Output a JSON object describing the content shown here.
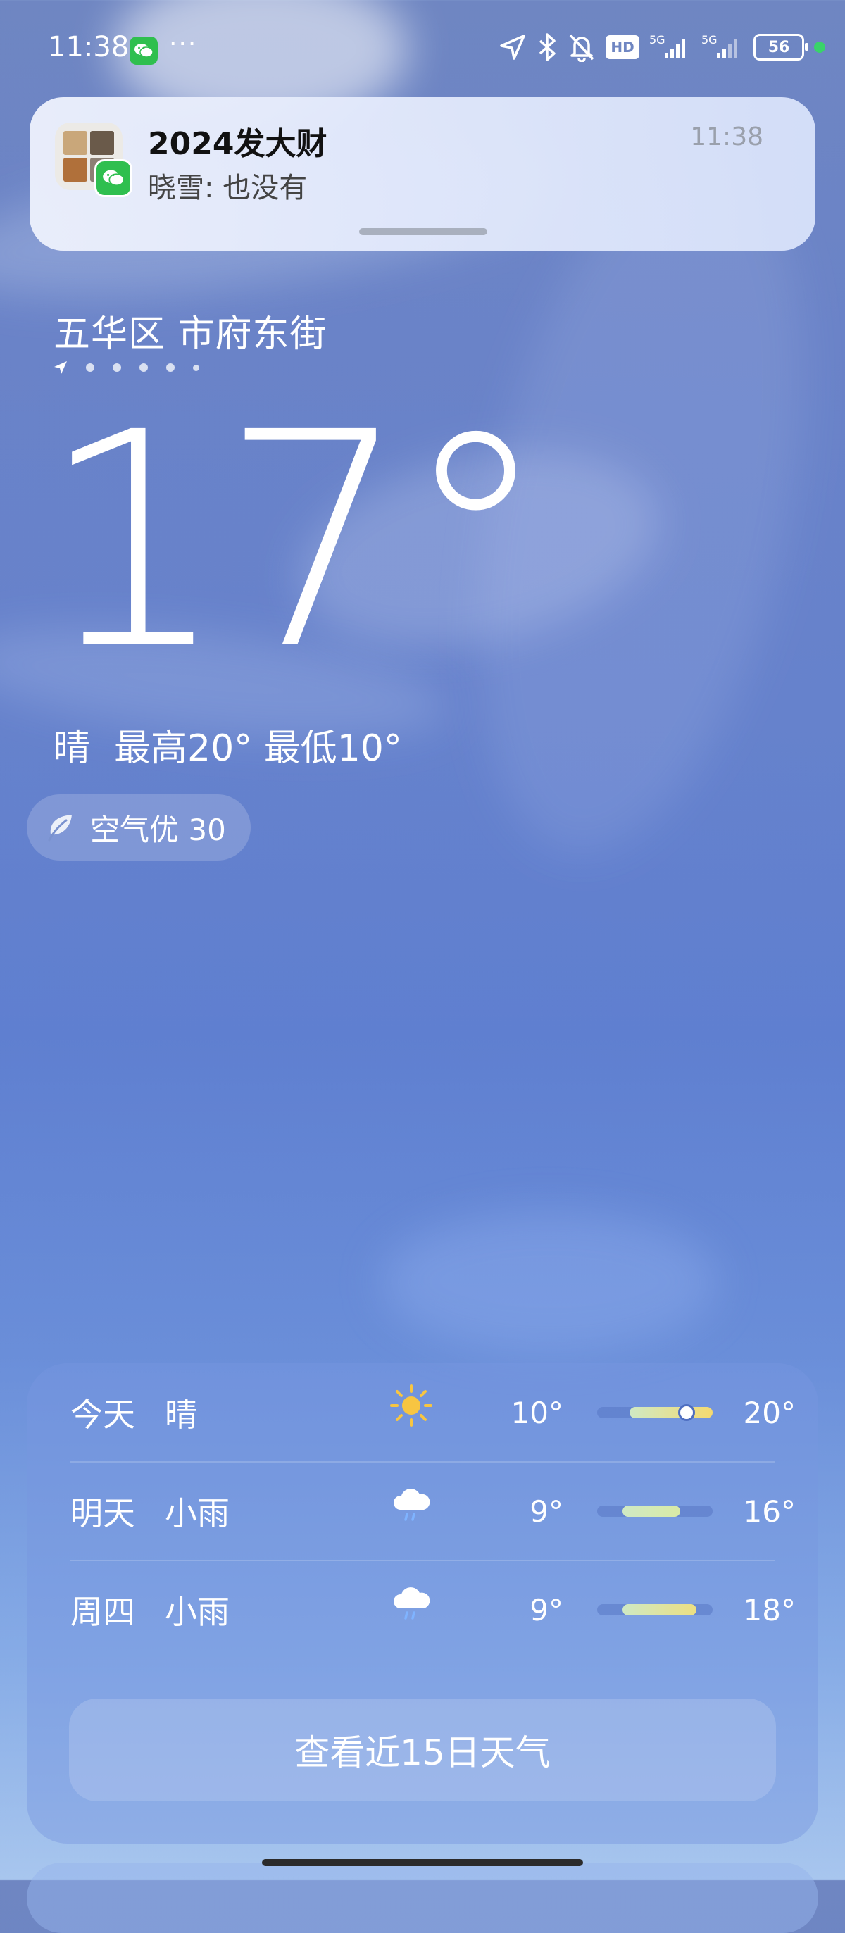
{
  "status_bar": {
    "time": "11:38",
    "overflow": "···",
    "hd_label": "HD",
    "net1": "5G",
    "net2": "5G",
    "battery": "56"
  },
  "notification": {
    "title": "2024发大财",
    "message": "晓雪: 也没有",
    "time": "11:38"
  },
  "location": {
    "name": "五华区 市府东街",
    "page_count": 6
  },
  "current": {
    "temperature": "17°",
    "condition": "晴",
    "high_low": "最高20° 最低10°"
  },
  "air_quality": {
    "label": "空气优 30"
  },
  "forecast": [
    {
      "day": "今天",
      "weather": "晴",
      "icon": "sun-icon",
      "low": "10°",
      "high": "20°",
      "bar_start": 0.28,
      "bar_end": 1.0,
      "current_pos": 0.76
    },
    {
      "day": "明天",
      "weather": "小雨",
      "icon": "cloud-rain-icon",
      "low": "9°",
      "high": "16°",
      "bar_start": 0.22,
      "bar_end": 0.72
    },
    {
      "day": "周四",
      "weather": "小雨",
      "icon": "cloud-rain-icon",
      "low": "9°",
      "high": "18°",
      "bar_start": 0.22,
      "bar_end": 0.86
    }
  ],
  "forecast_button": "查看近15日天气",
  "colors": {
    "accent_green": "#2fbf4f",
    "bar_fill_start": "#cfe9c4",
    "bar_fill_end": "#f5da70"
  }
}
